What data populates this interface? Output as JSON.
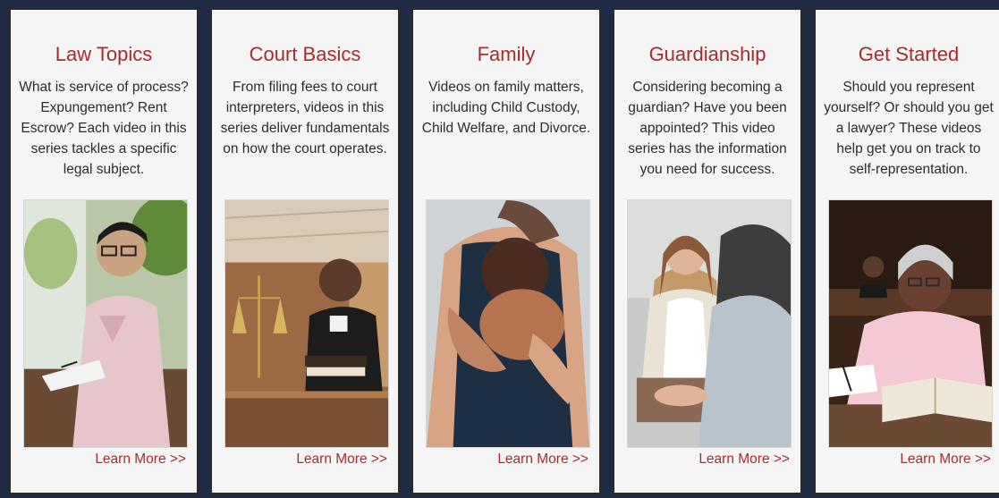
{
  "cards": [
    {
      "title": "Law Topics",
      "description": "What is service of process? Expungement? Rent Escrow? Each video in this series tackles a specific legal subject.",
      "link": "Learn More >>"
    },
    {
      "title": "Court Basics",
      "description": "From filing fees to court interpreters, videos in this series deliver fundamentals on how the court operates.",
      "link": "Learn More >>"
    },
    {
      "title": "Family",
      "description": "Videos on family matters, including Child Custody, Child Welfare, and Divorce.",
      "link": "Learn More >>"
    },
    {
      "title": "Guardianship",
      "description": "Considering becoming a guardian? Have you been appointed? This video series has the information you need for success.",
      "link": "Learn More >>"
    },
    {
      "title": "Get Started",
      "description": "Should you represent yourself? Or should you get a lawyer? These videos help get you on track to self-representation.",
      "link": "Learn More >>"
    }
  ],
  "colors": {
    "accent": "#a62b2e",
    "page_background": "#1f2a44",
    "card_background": "#f5f5f5",
    "card_border": "#2a2a2a",
    "body_text": "#2c2c2c"
  }
}
